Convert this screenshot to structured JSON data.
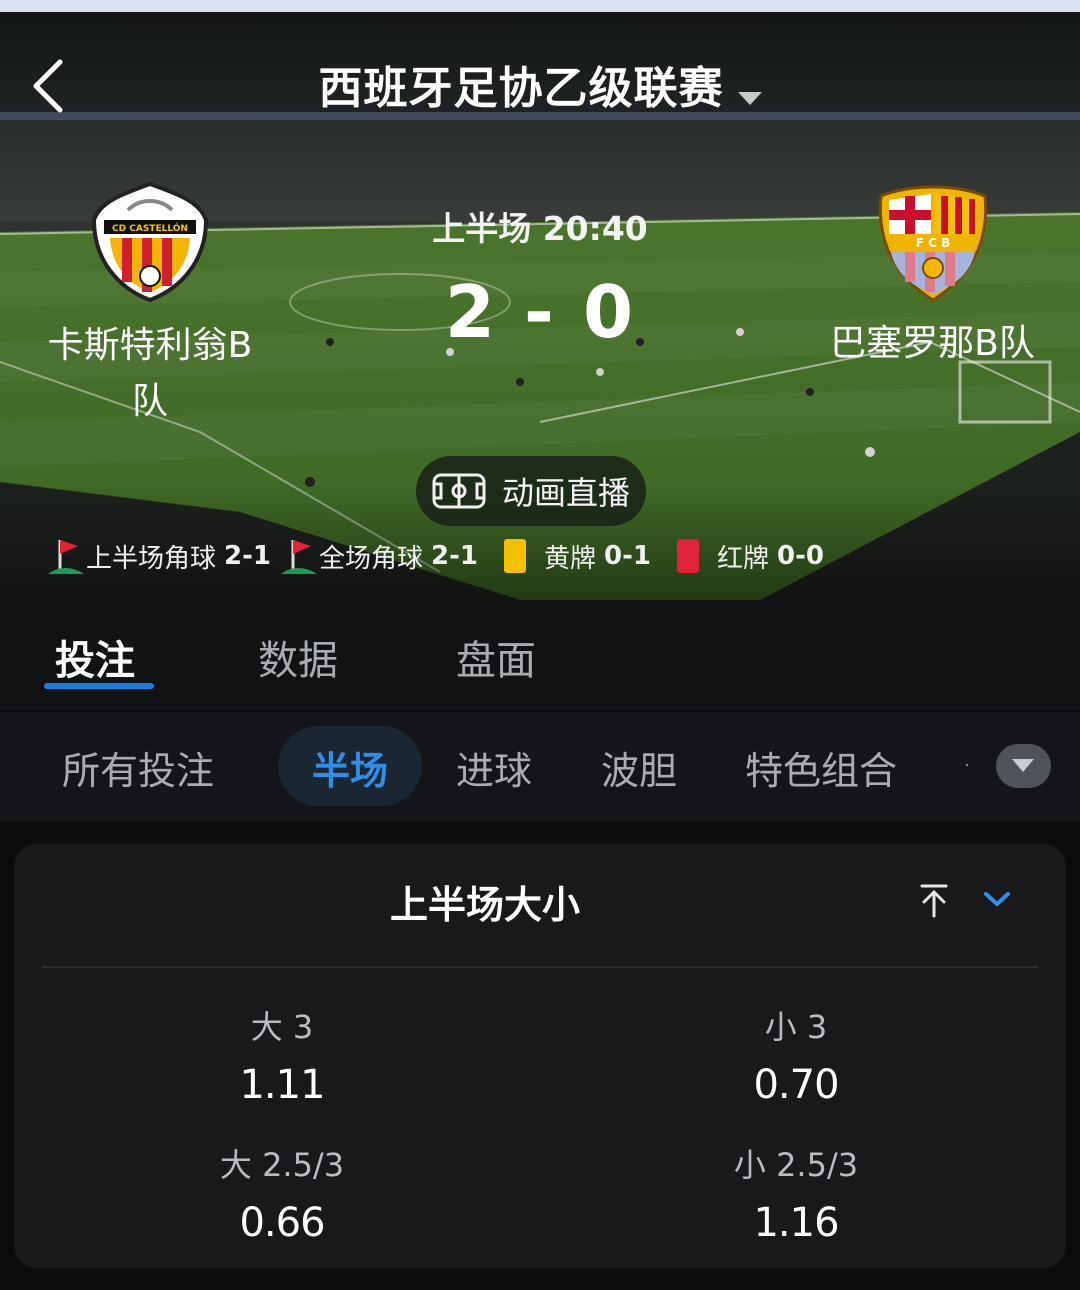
{
  "header": {
    "league_title": "西班牙足协乙级联赛"
  },
  "match": {
    "period_label": "上半场 20:40",
    "score": "2 - 0",
    "home_team": {
      "name_line1": "卡斯特利翁B",
      "name_line2": "队"
    },
    "away_team": {
      "name": "巴塞罗那B队"
    },
    "live_button_label": "动画直播"
  },
  "stats": {
    "first_half_corners": {
      "label": "上半场角球",
      "value": "2-1"
    },
    "full_corners": {
      "label": "全场角球",
      "value": "2-1"
    },
    "yellow_cards": {
      "label": "黄牌",
      "value": "0-1",
      "color": "#f2c200"
    },
    "red_cards": {
      "label": "红牌",
      "value": "0-0",
      "color": "#e3223a"
    }
  },
  "tabs": {
    "items": [
      "投注",
      "数据",
      "盘面"
    ],
    "active": "投注",
    "accent": "#1e7de0"
  },
  "subtabs": {
    "items": [
      "所有投注",
      "半场",
      "进球",
      "波胆",
      "特色组合"
    ],
    "active": "半场"
  },
  "market": {
    "title": "上半场大小",
    "odds": [
      {
        "label": "大 3",
        "value": "1.11"
      },
      {
        "label": "小 3",
        "value": "0.70"
      },
      {
        "label": "大 2.5/3",
        "value": "0.66"
      },
      {
        "label": "小 2.5/3",
        "value": "1.16"
      }
    ]
  },
  "icons": {
    "back": "chevron-left-icon",
    "live": "pitch-icon",
    "corner": "corner-flag-icon",
    "pin": "pin-to-top-icon",
    "collapse": "chevron-down-icon",
    "more": "caret-down-icon"
  }
}
